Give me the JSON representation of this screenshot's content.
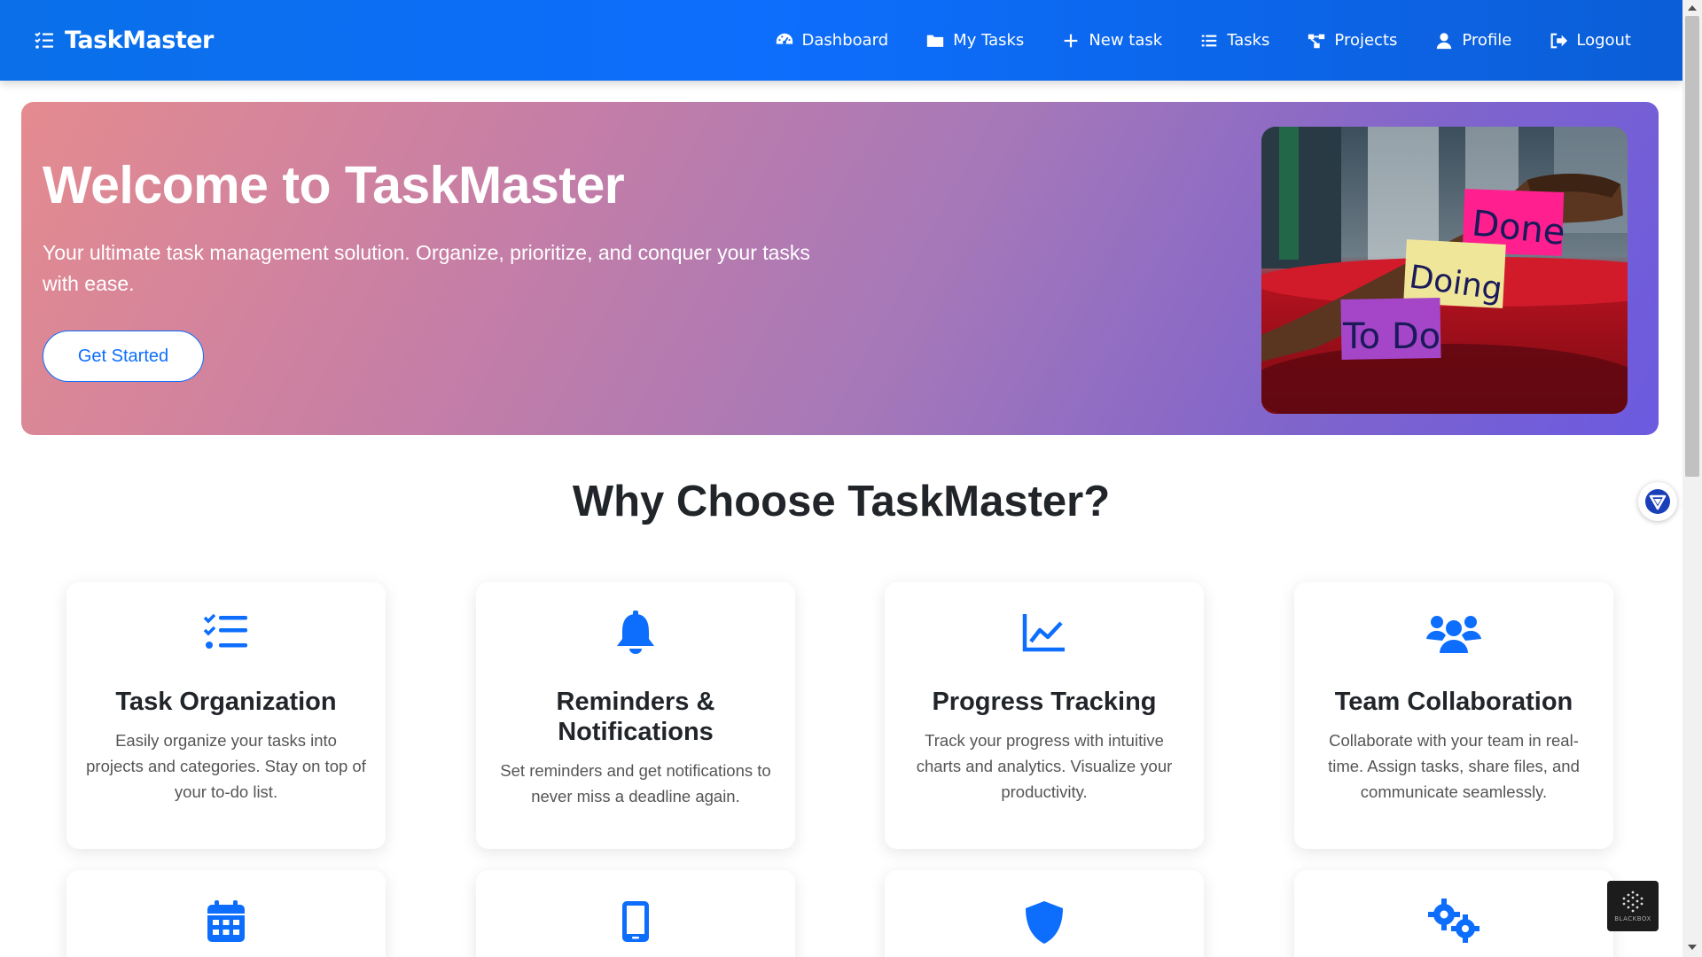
{
  "brand": {
    "name": "TaskMaster"
  },
  "nav": [
    {
      "label": "Dashboard",
      "icon": "dashboard-gauge-icon"
    },
    {
      "label": "My Tasks",
      "icon": "folder-icon"
    },
    {
      "label": "New task",
      "icon": "plus-icon"
    },
    {
      "label": "Tasks",
      "icon": "list-icon"
    },
    {
      "label": "Projects",
      "icon": "project-diagram-icon"
    },
    {
      "label": "Profile",
      "icon": "user-icon"
    },
    {
      "label": "Logout",
      "icon": "logout-icon"
    }
  ],
  "hero": {
    "title": "Welcome to TaskMaster",
    "subtitle": "Your ultimate task management solution. Organize, prioritize, and conquer your tasks with ease.",
    "cta": "Get Started",
    "image_notes": [
      "Done",
      "Doing",
      "To Do"
    ]
  },
  "features": {
    "title": "Why Choose TaskMaster?",
    "cards": [
      {
        "title": "Task Organization",
        "description": "Easily organize your tasks into projects and categories. Stay on top of your to-do list.",
        "icon": "list-check-icon"
      },
      {
        "title": "Reminders & Notifications",
        "description": "Set reminders and get notifications to never miss a deadline again.",
        "icon": "bell-icon"
      },
      {
        "title": "Progress Tracking",
        "description": "Track your progress with intuitive charts and analytics. Visualize your productivity.",
        "icon": "chart-line-icon"
      },
      {
        "title": "Team Collaboration",
        "description": "Collaborate with your team in real-time. Assign tasks, share files, and communicate seamlessly.",
        "icon": "users-icon"
      }
    ],
    "second_row_icons": [
      "calendar-icon",
      "mobile-icon",
      "shield-icon",
      "gears-icon"
    ]
  },
  "widgets": {
    "blackbox_label": "BLACKBOX"
  },
  "colors": {
    "primary": "#0d6efd",
    "hero_start": "#e48b8f",
    "hero_end": "#6b5ae0"
  }
}
